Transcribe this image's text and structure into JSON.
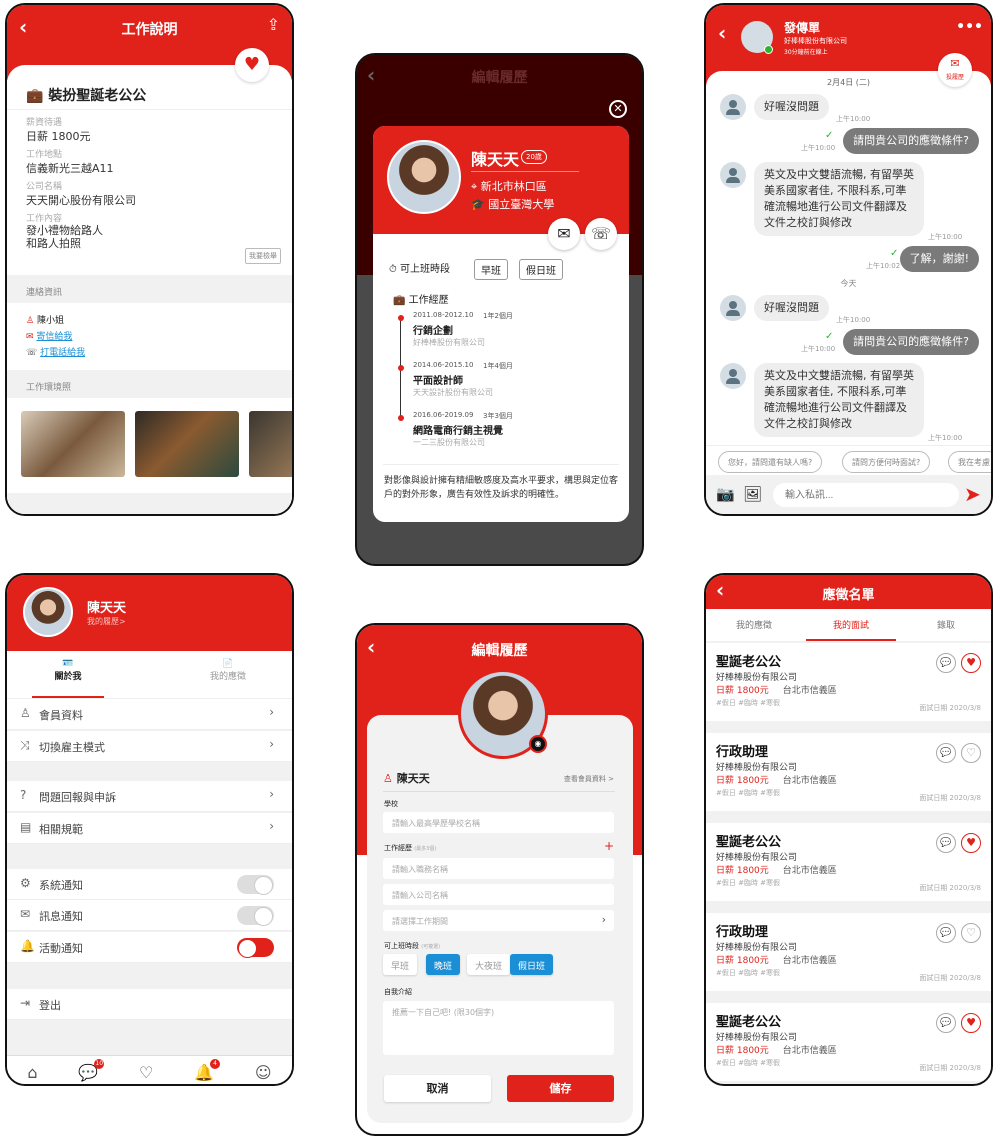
{
  "colors": {
    "brand_red": "#e0221b",
    "selected_blue": "#1a8fd6",
    "online_green": "#2bb52b"
  },
  "job_detail": {
    "header_title": "工作說明",
    "job_title": "裝扮聖誕老公公",
    "fields": [
      {
        "label": "薪資待遇",
        "value": "日薪 1800元"
      },
      {
        "label": "工作地點",
        "value": "信義新光三越A11"
      },
      {
        "label": "公司名稱",
        "value": "天天開心股份有限公司"
      },
      {
        "label": "工作內容",
        "value": "發小禮物給路人\n和路人拍照"
      }
    ],
    "report_label": "我要檢舉",
    "contact_section": "連絡資訊",
    "contact_name": "陳小姐",
    "email_link": "寄信給我",
    "phone_link": "打電話給我",
    "photos_section": "工作環境照",
    "favorited": true
  },
  "resume_modal": {
    "bg_title": "編輯履歷",
    "name": "陳天天",
    "age": "20歲",
    "location": "新北市林口區",
    "school": "國立臺灣大學",
    "shift_label": "可上班時段",
    "shifts": [
      "早班",
      "假日班"
    ],
    "experience_label": "工作經歷",
    "experience": [
      {
        "period": "2011.08-2012.10",
        "duration": "1年2個月",
        "title": "行銷企劃",
        "company": "好棒棒股份有限公司"
      },
      {
        "period": "2014.06-2015.10",
        "duration": "1年4個月",
        "title": "平面設計師",
        "company": "天天設計股份有限公司"
      },
      {
        "period": "2016.06-2019.09",
        "duration": "3年3個月",
        "title": "網路電商行銷主視覺",
        "company": "一二三股份有限公司"
      }
    ],
    "intro": "對影像與設計擁有精細敏感度及高水平要求，構思與定位客戶的對外形象，廣告有效性及訴求的明確性。"
  },
  "chat": {
    "contact_name": "發傳單",
    "company": "好棒棒股份有限公司",
    "status": "30分鐘前在線上",
    "resume_button": "投履歷",
    "date_label": "2月4日 (二)",
    "today_label": "今天",
    "messages": [
      {
        "side": "in",
        "text": "好喔沒問題",
        "time": "上午10:00"
      },
      {
        "side": "out",
        "text": "請問貴公司的應徵條件?",
        "time": "上午10:00"
      },
      {
        "side": "in",
        "text": "英文及中文雙語流暢, 有留學英美系國家者佳, 不限科系,可準確流暢地進行公司文件翻譯及文件之校訂與修改",
        "time": "上午10:00"
      },
      {
        "side": "out",
        "text": "了解，謝謝!",
        "time": "上午10:02"
      },
      {
        "side": "in",
        "text": "好喔沒問題",
        "time": "上午10:00"
      },
      {
        "side": "out",
        "text": "請問貴公司的應徵條件?",
        "time": "上午10:00"
      },
      {
        "side": "in",
        "text": "英文及中文雙語流暢, 有留學英美系國家者佳, 不限科系,可準確流暢地進行公司文件翻譯及文件之校訂與修改",
        "time": "上午10:00"
      }
    ],
    "quick_replies": [
      "您好，請問還有缺人嗎?",
      "請問方便何時面試?",
      "我在考慮"
    ],
    "input_placeholder": "輸入私訊..."
  },
  "profile": {
    "name": "陳天天",
    "resume_link": "我的履歷>",
    "tabs": [
      {
        "label": "關於我",
        "active": true
      },
      {
        "label": "我的應徵",
        "active": false
      }
    ],
    "group1": [
      {
        "label": "會員資料",
        "icon": "user-icon"
      },
      {
        "label": "切換雇主模式",
        "icon": "shuffle-icon"
      }
    ],
    "group2": [
      {
        "label": "問題回報與申訴",
        "icon": "question-icon"
      },
      {
        "label": "相關規範",
        "icon": "document-icon"
      }
    ],
    "notifications": [
      {
        "label": "系統通知",
        "icon": "gear-icon",
        "on": false
      },
      {
        "label": "訊息通知",
        "icon": "mail-icon",
        "on": false
      },
      {
        "label": "活動通知",
        "icon": "bell-icon",
        "on": true
      }
    ],
    "logout": "登出",
    "nav": [
      {
        "icon": "home-icon"
      },
      {
        "icon": "chat-icon",
        "badge": "10"
      },
      {
        "icon": "heart-icon"
      },
      {
        "icon": "bell-icon",
        "badge": "4"
      },
      {
        "icon": "profile-icon"
      }
    ]
  },
  "edit_resume": {
    "title": "編輯履歷",
    "name": "陳天天",
    "view_member": "查看會員資料 >",
    "school_label": "學校",
    "school_placeholder": "請輸入最高學歷學校名稱",
    "exp_label": "工作經歷",
    "exp_note": "(最多3個)",
    "job_placeholder": "請輸入職務名稱",
    "company_placeholder": "請輸入公司名稱",
    "period_placeholder": "請選擇工作期間",
    "shift_label": "可上班時段",
    "shift_note": "(可複選)",
    "shifts": [
      {
        "label": "早班",
        "selected": false
      },
      {
        "label": "晚班",
        "selected": true
      },
      {
        "label": "大夜班",
        "selected": false
      },
      {
        "label": "假日班",
        "selected": true
      }
    ],
    "intro_label": "自我介紹",
    "intro_placeholder": "推薦一下自己吧!  (限30個字)",
    "cancel": "取消",
    "save": "儲存"
  },
  "applications": {
    "title": "應徵名單",
    "tabs": [
      {
        "label": "我的應徵",
        "active": false
      },
      {
        "label": "我的面試",
        "active": true
      },
      {
        "label": "錄取",
        "active": false
      }
    ],
    "items": [
      {
        "title": "聖誕老公公",
        "company": "好棒棒股份有限公司",
        "salary": "日薪 1800元",
        "location": "台北市信義區",
        "tags": "#假日 #臨時 #寒假",
        "date": "面試日期 2020/3/8",
        "favorited": true
      },
      {
        "title": "行政助理",
        "company": "好棒棒股份有限公司",
        "salary": "日薪 1800元",
        "location": "台北市信義區",
        "tags": "#假日 #臨時 #寒假",
        "date": "面試日期 2020/3/8",
        "favorited": false
      },
      {
        "title": "聖誕老公公",
        "company": "好棒棒股份有限公司",
        "salary": "日薪 1800元",
        "location": "台北市信義區",
        "tags": "#假日 #臨時 #寒假",
        "date": "面試日期 2020/3/8",
        "favorited": true
      },
      {
        "title": "行政助理",
        "company": "好棒棒股份有限公司",
        "salary": "日薪 1800元",
        "location": "台北市信義區",
        "tags": "#假日 #臨時 #寒假",
        "date": "面試日期 2020/3/8",
        "favorited": false
      },
      {
        "title": "聖誕老公公",
        "company": "好棒棒股份有限公司",
        "salary": "日薪 1800元",
        "location": "台北市信義區",
        "tags": "#假日 #臨時 #寒假",
        "date": "面試日期 2020/3/8",
        "favorited": true
      }
    ]
  }
}
